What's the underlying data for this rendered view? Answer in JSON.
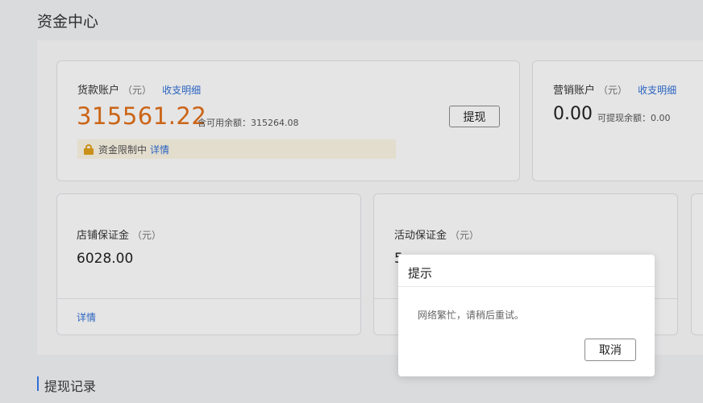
{
  "page": {
    "title": "资金中心"
  },
  "loan_account": {
    "label": "货款账户",
    "unit": "（元）",
    "detail_link": "收支明细",
    "balance": "315561.22",
    "available_text": "含可用余额：315264.08",
    "withdraw_button": "提现",
    "restriction_text": "资金限制中",
    "restriction_link": "详情"
  },
  "marketing_account": {
    "label": "营销账户",
    "unit": "（元）",
    "detail_link": "收支明细",
    "balance": "0.00",
    "withdrawable_text": "可提现余额：0.00"
  },
  "shop_deposit": {
    "label": "店铺保证金",
    "unit": "（元）",
    "amount": "6028.00",
    "detail_link": "详情"
  },
  "activity_deposit": {
    "label": "活动保证金",
    "unit": "（元）",
    "amount_partial": "5"
  },
  "section": {
    "withdraw_records": "提现记录"
  },
  "dialog": {
    "title": "提示",
    "message": "网络繁忙，请稍后重试。",
    "cancel_button": "取消"
  },
  "colors": {
    "accent_orange": "#e3711b",
    "link_blue": "#2f6fd6",
    "lock_gold": "#e0a21b"
  }
}
